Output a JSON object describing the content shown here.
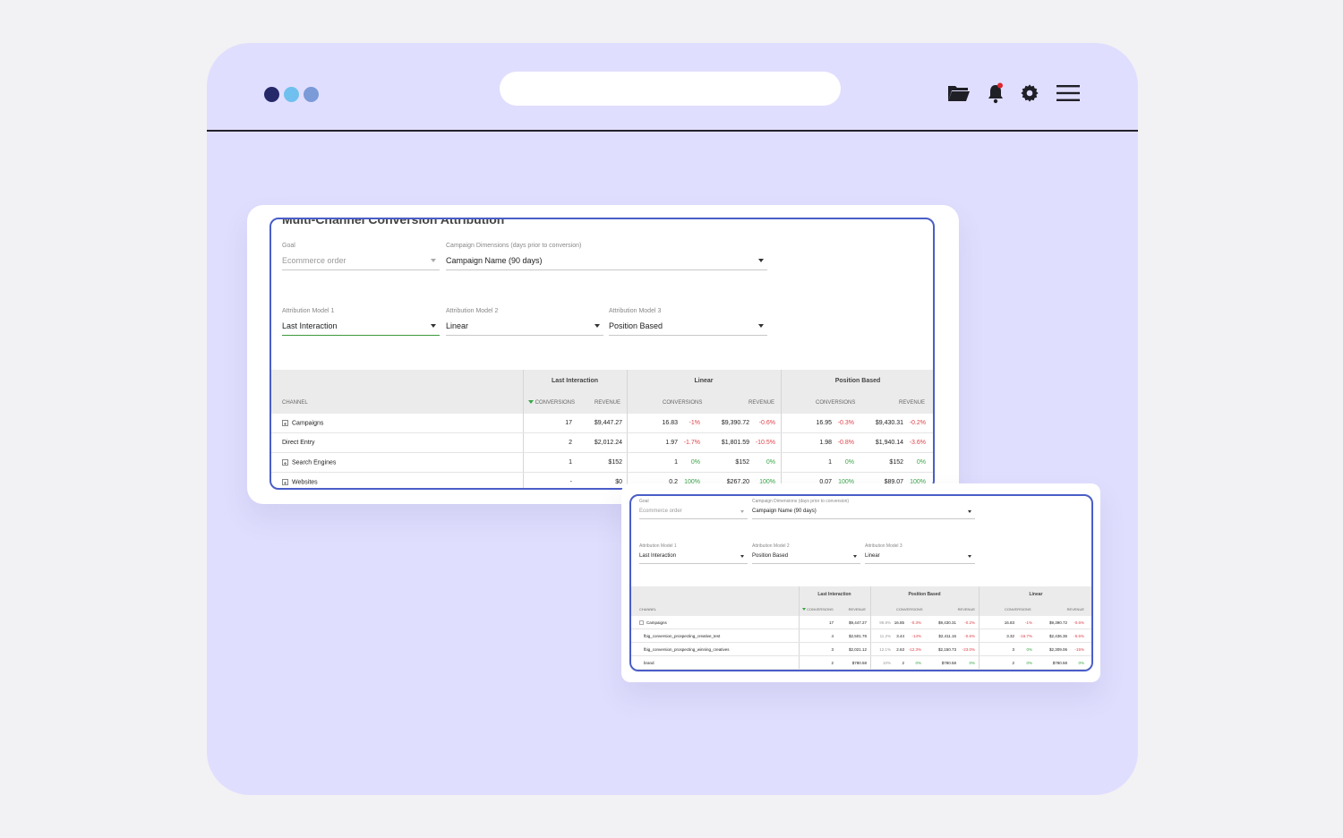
{
  "icons": {
    "folder": "folder-open-icon",
    "bell": "bell-icon",
    "settings": "gear-icon",
    "menu": "hamburger-menu-icon"
  },
  "colors": {
    "window_bg": "#e0defe",
    "accent_border": "#4a5ec8",
    "negative": "#e0424b",
    "positive": "#3aa548",
    "notification": "#e0242b"
  },
  "card1": {
    "ghost_title": "Multi-Channel Conversion Attribution",
    "goal_label": "Goal",
    "goal_value": "Ecommerce order",
    "campaign_dim_label": "Campaign Dimensions (days prior to conversion)",
    "campaign_dim_value": "Campaign Name (90 days)",
    "model1_label": "Attribution Model 1",
    "model1_value": "Last Interaction",
    "model2_label": "Attribution Model 2",
    "model2_value": "Linear",
    "model3_label": "Attribution Model 3",
    "model3_value": "Position Based",
    "table": {
      "channel_header": "CHANNEL",
      "groups": [
        "Last Interaction",
        "Linear",
        "Position Based"
      ],
      "conv_header": "CONVERSIONS",
      "rev_header": "REVENUE",
      "rows": [
        {
          "channel": "Campaigns",
          "expandable": true,
          "c1": "17",
          "r1": "$9,447.27",
          "c2": "16.83",
          "c2d": "-1%",
          "r2": "$9,390.72",
          "r2d": "-0.6%",
          "c3": "16.95",
          "c3d": "-0.3%",
          "r3": "$9,430.31",
          "r3d": "-0.2%"
        },
        {
          "channel": "Direct Entry",
          "expandable": false,
          "c1": "2",
          "r1": "$2,012.24",
          "c2": "1.97",
          "c2d": "-1.7%",
          "r2": "$1,801.59",
          "r2d": "-10.5%",
          "c3": "1.98",
          "c3d": "-0.8%",
          "r3": "$1,940.14",
          "r3d": "-3.6%"
        },
        {
          "channel": "Search Engines",
          "expandable": true,
          "c1": "1",
          "r1": "$152",
          "c2": "1",
          "c2d": "0%",
          "r2": "$152",
          "r2d": "0%",
          "c3": "1",
          "c3d": "0%",
          "r3": "$152",
          "r3d": "0%"
        },
        {
          "channel": "Websites",
          "expandable": true,
          "c1": "-",
          "r1": "$0",
          "c2": "0.2",
          "c2d": "100%",
          "r2": "$267.20",
          "r2d": "100%",
          "c3": "0.07",
          "c3d": "100%",
          "r3": "$89.07",
          "r3d": "100%"
        }
      ]
    }
  },
  "card2": {
    "goal_label": "Goal",
    "goal_value": "Ecommerce order",
    "campaign_dim_label": "Campaign Dimensions (days prior to conversion)",
    "campaign_dim_value": "Campaign Name (90 days)",
    "model1_label": "Attribution Model 1",
    "model1_value": "Last Interaction",
    "model2_label": "Attribution Model 2",
    "model2_value": "Position Based",
    "model3_label": "Attribution Model 3",
    "model3_value": "Linear",
    "table": {
      "channel_header": "CHANNEL",
      "groups": [
        "Last Interaction",
        "Position Based",
        "Linear"
      ],
      "conv_header": "CONVERSIONS",
      "rev_header": "REVENUE",
      "rows": [
        {
          "channel": "Campaigns",
          "expandable": true,
          "c1": "17",
          "r1": "$9,447.27",
          "s2": "99.8%",
          "c2": "16.85",
          "c2d": "-0.3%",
          "r2": "$9,430.31",
          "r2d": "-0.2%",
          "c3": "16.83",
          "c3d": "-1%",
          "r3": "$9,390.72",
          "r3d": "-0.6%"
        },
        {
          "channel": "fbig_conversion_prospecting_creative_test",
          "expandable": false,
          "c1": "4",
          "r1": "$2,501.78",
          "s2": "11.2%",
          "c2": "3.44",
          "c2d": "-14%",
          "r2": "$2,411.16",
          "r2d": "-0.6%",
          "c3": "3.32",
          "c3d": "-16.7%",
          "r3": "$2,436.36",
          "r3d": "-5.5%"
        },
        {
          "channel": "fbig_conversion_prospecting_winning_creatives",
          "expandable": false,
          "c1": "3",
          "r1": "$2,021.12",
          "s2": "12.1%",
          "c2": "2.63",
          "c2d": "-12.3%",
          "r2": "$2,150.73",
          "r2d": "-23.0%",
          "c3": "3",
          "c3d": "0%",
          "r3": "$2,309.06",
          "r3d": "-15%"
        },
        {
          "channel": "brand",
          "expandable": false,
          "c1": "2",
          "r1": "$780.58",
          "s2": "10%",
          "c2": "2",
          "c2d": "0%",
          "r2": "$780.58",
          "r2d": "0%",
          "c3": "2",
          "c3d": "0%",
          "r3": "$780.58",
          "r3d": "0%"
        }
      ]
    }
  }
}
